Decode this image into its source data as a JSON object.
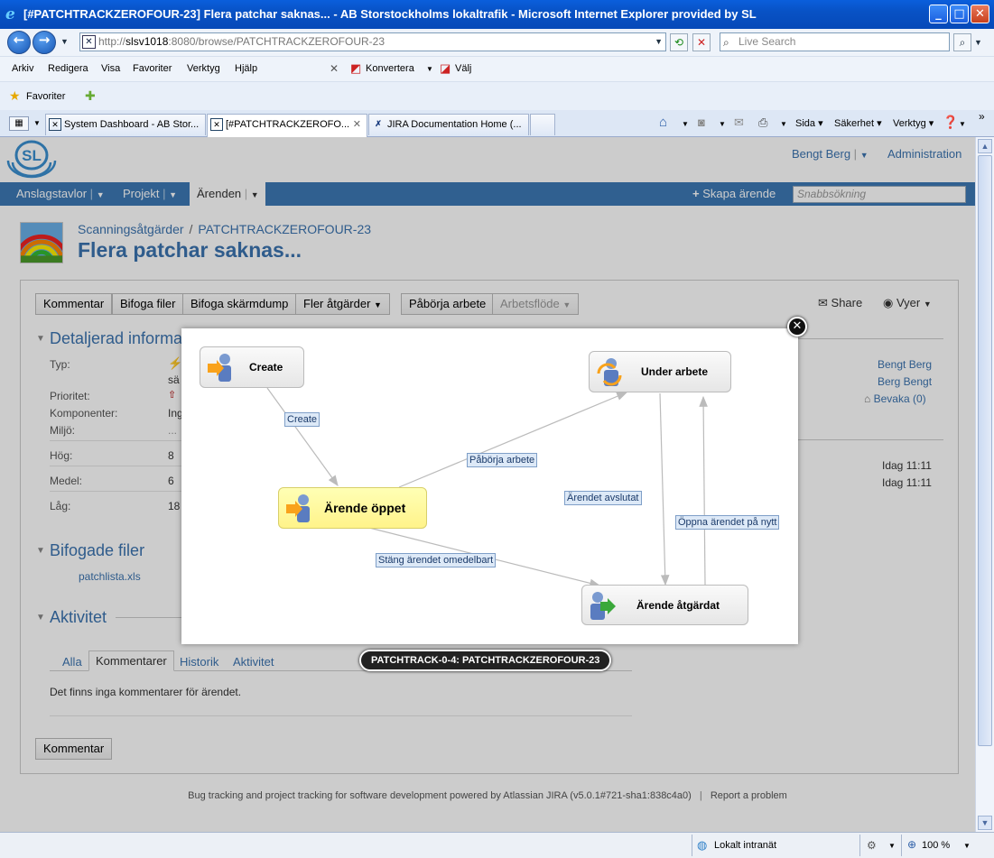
{
  "window": {
    "title": "[#PATCHTRACKZEROFOUR-23] Flera patchar saknas... - AB Storstockholms lokaltrafik - Microsoft Internet Explorer provided by SL"
  },
  "browser": {
    "address_prefix": "http://",
    "address_host": "slsv1018",
    "address_rest": ":8080/browse/PATCHTRACKZEROFOUR-23",
    "search_placeholder": "Live Search",
    "menu": [
      "Arkiv",
      "Redigera",
      "Visa",
      "Favoriter",
      "Verktyg",
      "Hjälp"
    ],
    "toolbar_convert": "Konvertera",
    "toolbar_select": "Välj",
    "favorites_label": "Favoriter",
    "tabs": [
      "System Dashboard - AB Stor...",
      "[#PATCHTRACKZEROFO...",
      "JIRA Documentation Home (..."
    ],
    "cmd_page": "Sida",
    "cmd_security": "Säkerhet",
    "cmd_tools": "Verktyg",
    "status_zone": "Lokalt intranät",
    "zoom": "100 %"
  },
  "jira": {
    "user": "Bengt Berg",
    "admin": "Administration",
    "nav": [
      "Anslagstavlor",
      "Projekt",
      "Ärenden"
    ],
    "create_issue": "Skapa ärende",
    "quick_search": "Snabbsökning",
    "breadcrumb_project": "Scanningsåtgärder",
    "breadcrumb_sep": "/",
    "breadcrumb_key": "PATCHTRACKZEROFOUR-23",
    "issue_title": "Flera patchar saknas...",
    "ops": [
      "Kommentar",
      "Bifoga filer",
      "Bifoga skärmdump",
      "Fler åtgärder",
      "Påbörja arbete",
      "Arbetsflöde"
    ],
    "share": "Share",
    "views": "Vyer",
    "details_title": "Detaljerad informa",
    "fields": [
      {
        "label": "Typ:",
        "value": "sä"
      },
      {
        "label": "Prioritet:",
        "value": ""
      },
      {
        "label": "Komponenter:",
        "value": "Ing"
      },
      {
        "label": "Miljö:",
        "value": "..."
      },
      {
        "label": "Hög:",
        "value": "8"
      },
      {
        "label": "Medel:",
        "value": "6"
      },
      {
        "label": "Låg:",
        "value": "18"
      }
    ],
    "people": [
      "Bengt Berg",
      "Berg Bengt"
    ],
    "watch": "Bevaka (0)",
    "dates": [
      "Idag 11:11",
      "Idag 11:11"
    ],
    "attachments_title": "Bifogade filer",
    "attachment": "patchlista.xls",
    "activity_title": "Aktivitet",
    "activity_tabs": [
      "Alla",
      "Kommentarer",
      "Historik",
      "Aktivitet"
    ],
    "no_comments": "Det finns inga kommentarer för ärendet.",
    "comment_button": "Kommentar",
    "footer": "Bug tracking and project tracking for software development powered by Atlassian JIRA (v5.0.1#721-sha1:838c4a0)",
    "footer_sep": "|",
    "footer_report": "Report a problem"
  },
  "workflow": {
    "caption": "PATCHTRACK-0-4: PATCHTRACKZEROFOUR-23",
    "nodes": {
      "create": "Create",
      "under": "Under arbete",
      "open": "Ärende öppet",
      "resolved": "Ärende åtgärdat"
    },
    "transitions": {
      "create": "Create",
      "start": "Påbörja arbete",
      "done": "Ärendet avslutat",
      "close": "Stäng ärendet omedelbart",
      "reopen": "Öppna ärendet på nytt"
    }
  },
  "colors": {
    "jira_blue": "#3b73af",
    "nav_bar": "#3c78b5",
    "current_state": "#fff38a"
  }
}
